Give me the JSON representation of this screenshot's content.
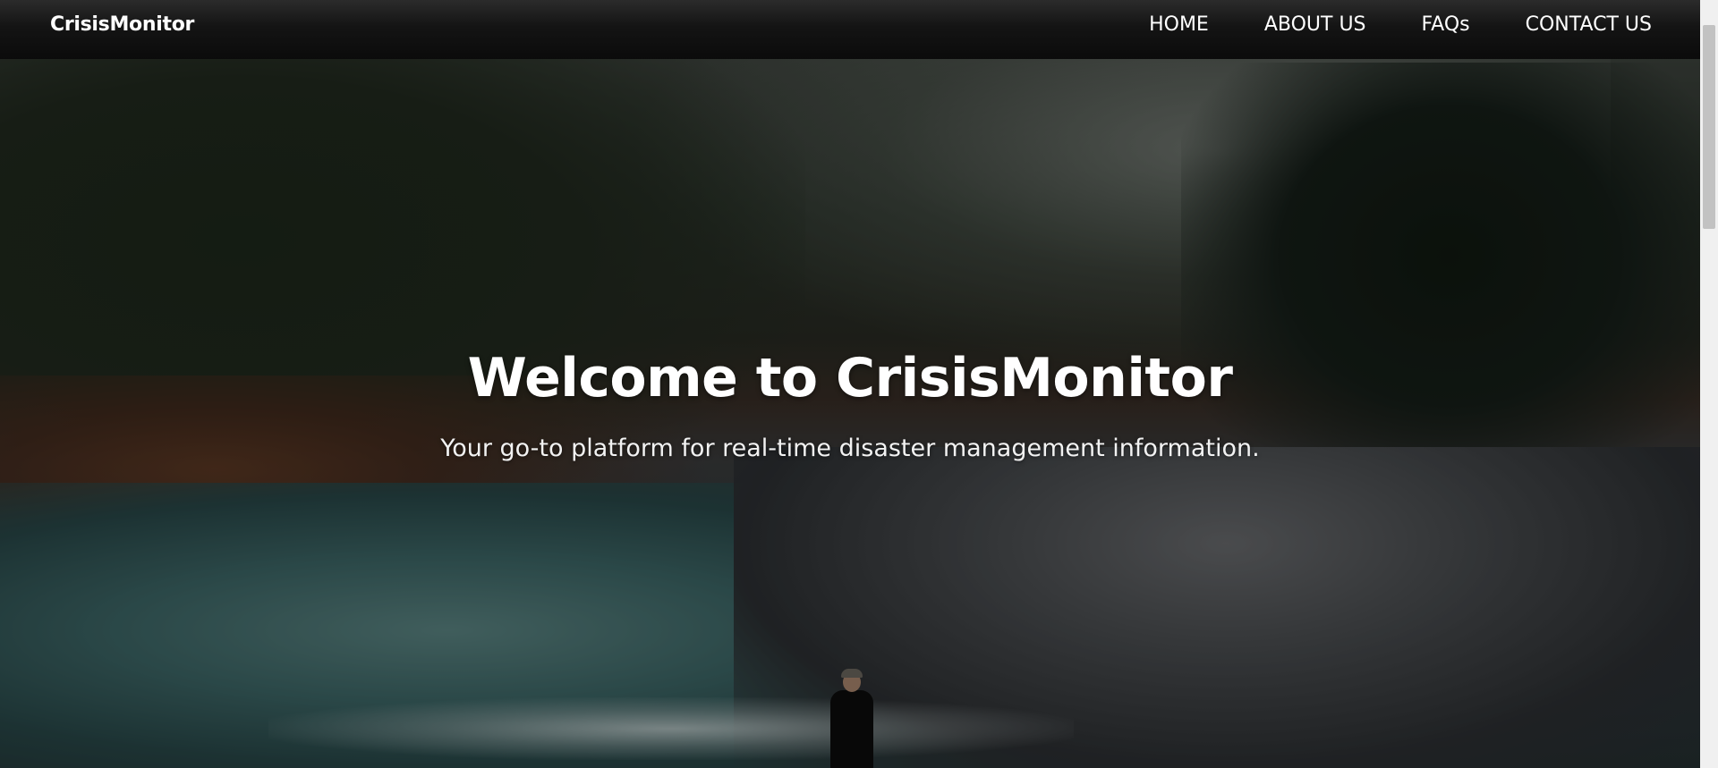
{
  "brand": {
    "name": "CrisisMonitor"
  },
  "nav": {
    "items": [
      {
        "label": "HOME"
      },
      {
        "label": "ABOUT US"
      },
      {
        "label": "FAQs"
      },
      {
        "label": "CONTACT US"
      }
    ]
  },
  "hero": {
    "title": "Welcome to CrisisMonitor",
    "subtitle": "Your go-to platform for real-time disaster management information.",
    "background_image": "forest-river-photo"
  },
  "colors": {
    "navbar": "#0b0b0b",
    "text": "#ffffff"
  }
}
